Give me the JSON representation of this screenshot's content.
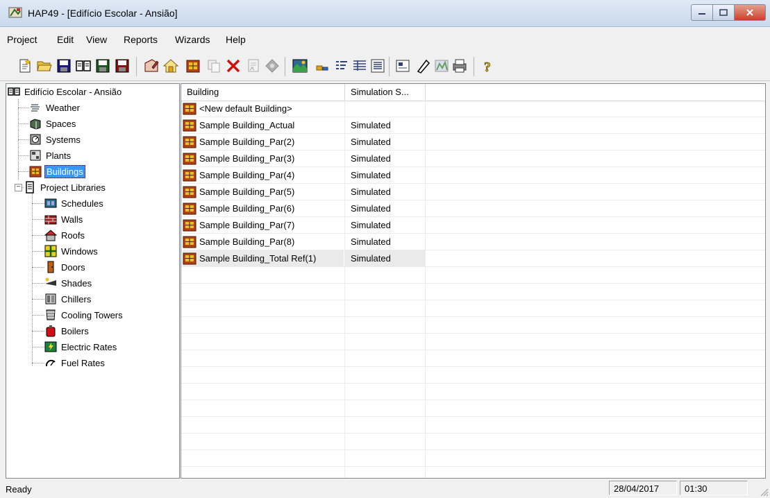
{
  "window": {
    "title": "HAP49 - [Edifício Escolar - Ansião]",
    "controls": [
      "minimize",
      "maximize",
      "close"
    ]
  },
  "menu": [
    "Project",
    "Edit",
    "View",
    "Reports",
    "Wizards",
    "Help"
  ],
  "toolbar": {
    "buttons": [
      "new-project-icon",
      "open-icon",
      "save-icon",
      "project-library-icon",
      "save-as-icon",
      "archive-icon",
      "edit-properties-icon",
      "import-icon",
      "building-icon",
      "copy-icon",
      "delete-icon",
      "report-icon",
      "calculate-icon",
      "building-view-icon",
      "small-icons-icon",
      "list-icon",
      "details-icon",
      "report-view-icon",
      "large-icons-icon",
      "edit-item-icon",
      "chart-icon",
      "print-icon",
      "help-icon"
    ]
  },
  "tree": {
    "root": "Edifício Escolar - Ansião",
    "items": [
      {
        "label": "Weather",
        "icon": "weather-icon"
      },
      {
        "label": "Spaces",
        "icon": "spaces-icon"
      },
      {
        "label": "Systems",
        "icon": "systems-icon"
      },
      {
        "label": "Plants",
        "icon": "plants-icon"
      },
      {
        "label": "Buildings",
        "icon": "buildings-icon",
        "selected": true
      }
    ],
    "libraries": {
      "label": "Project Libraries",
      "expanded": true,
      "items": [
        {
          "label": "Schedules",
          "icon": "schedules-icon"
        },
        {
          "label": "Walls",
          "icon": "walls-icon"
        },
        {
          "label": "Roofs",
          "icon": "roofs-icon"
        },
        {
          "label": "Windows",
          "icon": "windows-icon"
        },
        {
          "label": "Doors",
          "icon": "doors-icon"
        },
        {
          "label": "Shades",
          "icon": "shades-icon"
        },
        {
          "label": "Chillers",
          "icon": "chillers-icon"
        },
        {
          "label": "Cooling Towers",
          "icon": "cooling-towers-icon"
        },
        {
          "label": "Boilers",
          "icon": "boilers-icon"
        },
        {
          "label": "Electric Rates",
          "icon": "electric-rates-icon"
        },
        {
          "label": "Fuel Rates",
          "icon": "fuel-rates-icon"
        }
      ]
    }
  },
  "list": {
    "columns": [
      "Building",
      "Simulation S..."
    ],
    "rows": [
      {
        "name": "<New default Building>",
        "status": ""
      },
      {
        "name": "Sample Building_Actual",
        "status": "Simulated"
      },
      {
        "name": "Sample Building_Par(2)",
        "status": "Simulated"
      },
      {
        "name": "Sample Building_Par(3)",
        "status": "Simulated"
      },
      {
        "name": "Sample Building_Par(4)",
        "status": "Simulated"
      },
      {
        "name": "Sample Building_Par(5)",
        "status": "Simulated"
      },
      {
        "name": "Sample Building_Par(6)",
        "status": "Simulated"
      },
      {
        "name": "Sample Building_Par(7)",
        "status": "Simulated"
      },
      {
        "name": "Sample Building_Par(8)",
        "status": "Simulated"
      },
      {
        "name": "Sample Building_Total Ref(1)",
        "status": "Simulated",
        "highlighted": true
      }
    ]
  },
  "statusbar": {
    "text": "Ready",
    "date": "28/04/2017",
    "time": "01:30"
  },
  "colors": {
    "selection": "#3399ff",
    "building_icon": "#b3411c",
    "close_button": "#c7402a"
  }
}
